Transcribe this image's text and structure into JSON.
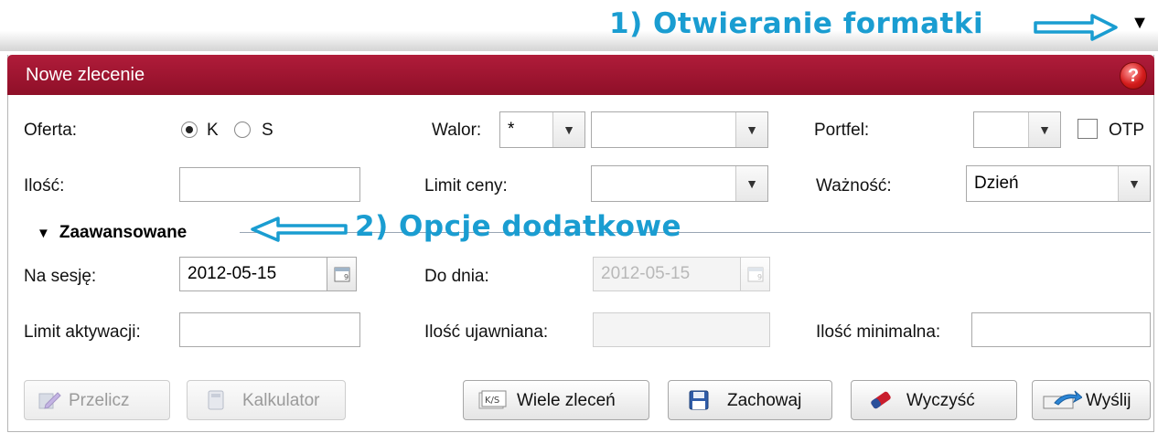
{
  "annotations": {
    "step1": "1) Otwieranie formatki",
    "step2": "2) Opcje dodatkowe"
  },
  "panel": {
    "title": "Nowe zlecenie",
    "help_label": "?"
  },
  "form": {
    "oferta_label": "Oferta:",
    "oferta_options": [
      "K",
      "S"
    ],
    "oferta_selected": "K",
    "walor_label": "Walor:",
    "walor_select1": "*",
    "walor_select2": "",
    "portfel_label": "Portfel:",
    "portfel_value": "",
    "otp_label": "OTP",
    "otp_checked": false,
    "ilosc_label": "Ilość:",
    "ilosc_value": "",
    "limit_ceny_label": "Limit ceny:",
    "limit_ceny_value": "",
    "waznosc_label": "Ważność:",
    "waznosc_value": "Dzień"
  },
  "advanced": {
    "toggle_label": "Zaawansowane",
    "na_sesje_label": "Na sesję:",
    "na_sesje_value": "2012-05-15",
    "do_dnia_label": "Do dnia:",
    "do_dnia_value": "2012-05-15",
    "limit_aktywacji_label": "Limit aktywacji:",
    "limit_aktywacji_value": "",
    "ilosc_ujawniana_label": "Ilość ujawniana:",
    "ilosc_ujawniana_value": "",
    "ilosc_minimalna_label": "Ilość minimalna:",
    "ilosc_minimalna_value": ""
  },
  "buttons": {
    "przelicz": "Przelicz",
    "kalkulator": "Kalkulator",
    "wiele_zlecen": "Wiele zleceń",
    "zachowaj": "Zachowaj",
    "wyczysc": "Wyczyść",
    "wyslij": "Wyślij"
  },
  "icons": {
    "help": "help-icon",
    "calendar": "calendar-icon",
    "save": "floppy-disk-icon",
    "eraser": "eraser-icon",
    "send": "send-arrow-icon",
    "multi": "ks-icon",
    "calculator": "calculator-icon",
    "recalc": "pencil-icon"
  },
  "colors": {
    "titlebar": "#9e1530",
    "annotation": "#1a9dd1"
  }
}
